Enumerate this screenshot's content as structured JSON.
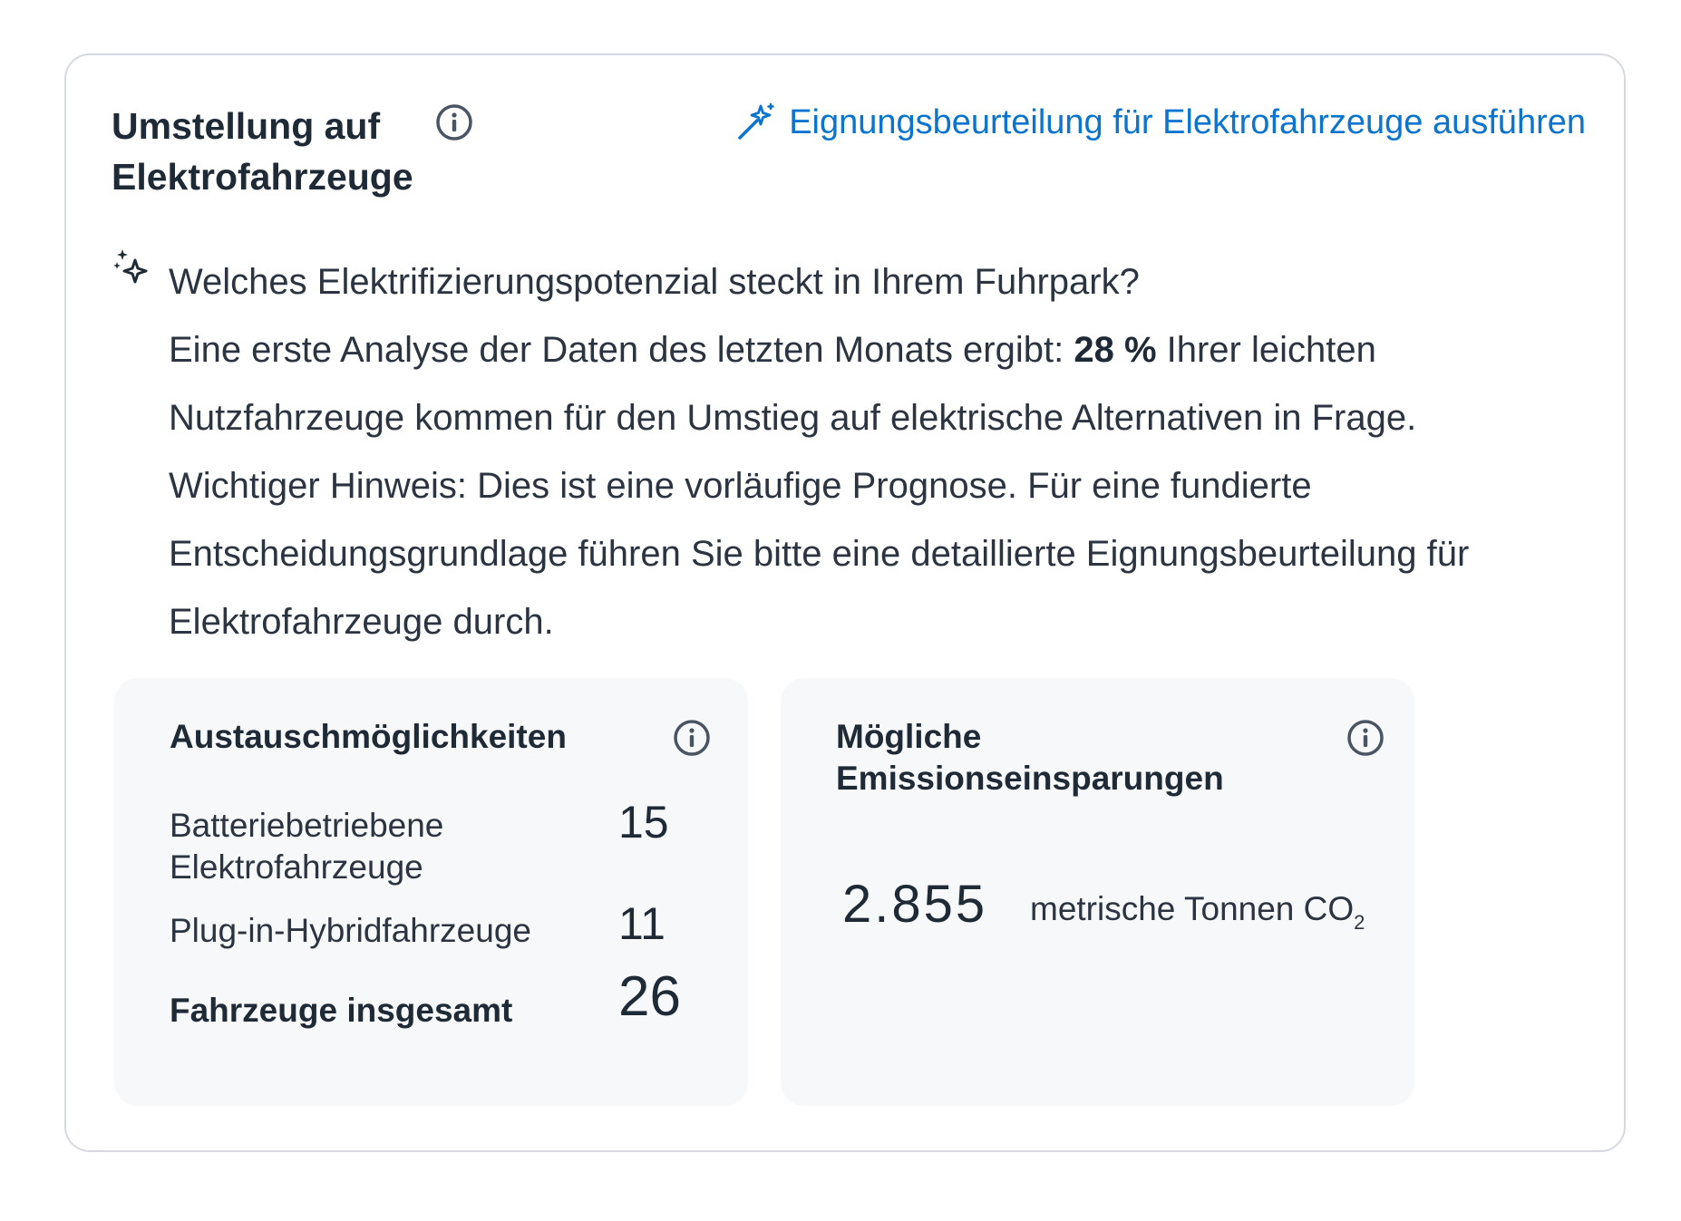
{
  "header": {
    "title": "Umstellung auf Elektrofahrzeuge",
    "action_label": "Eignungsbeurteilung für Elektrofahrzeuge ausführen"
  },
  "intro": {
    "question": "Welches Elektrifizierungspotenzial steckt in Ihrem Fuhrpark?",
    "analysis_prefix": "Eine erste Analyse der Daten des letzten Monats ergibt: ",
    "analysis_percent": "28 %",
    "analysis_suffix": " Ihrer leichten Nutzfahrzeuge kommen für den Umstieg auf elektrische Alternativen in Frage.",
    "note": "Wichtiger Hinweis: Dies ist eine vorläufige Prognose. Für eine fundierte Entscheidungsgrundlage führen Sie bitte eine detaillierte Eignungsbeurteilung für Elektrofahrzeuge durch."
  },
  "replacement": {
    "title": "Austauschmöglichkeiten",
    "rows": [
      {
        "label": "Batteriebetriebene Elektrofahrzeuge",
        "value": "15"
      },
      {
        "label": "Plug-in-Hybridfahrzeuge",
        "value": "11"
      },
      {
        "label": "Fahrzeuge insgesamt",
        "value": "26"
      }
    ]
  },
  "emissions": {
    "title": "Mögliche Emissionseinsparungen",
    "value": "2.855",
    "unit_prefix": "metrische Tonnen CO",
    "unit_subscript": "2"
  },
  "colors": {
    "accent": "#0a74cf",
    "icon": "#4a5563",
    "panel_bg": "#f7f8fa",
    "border": "#d6dae0"
  }
}
